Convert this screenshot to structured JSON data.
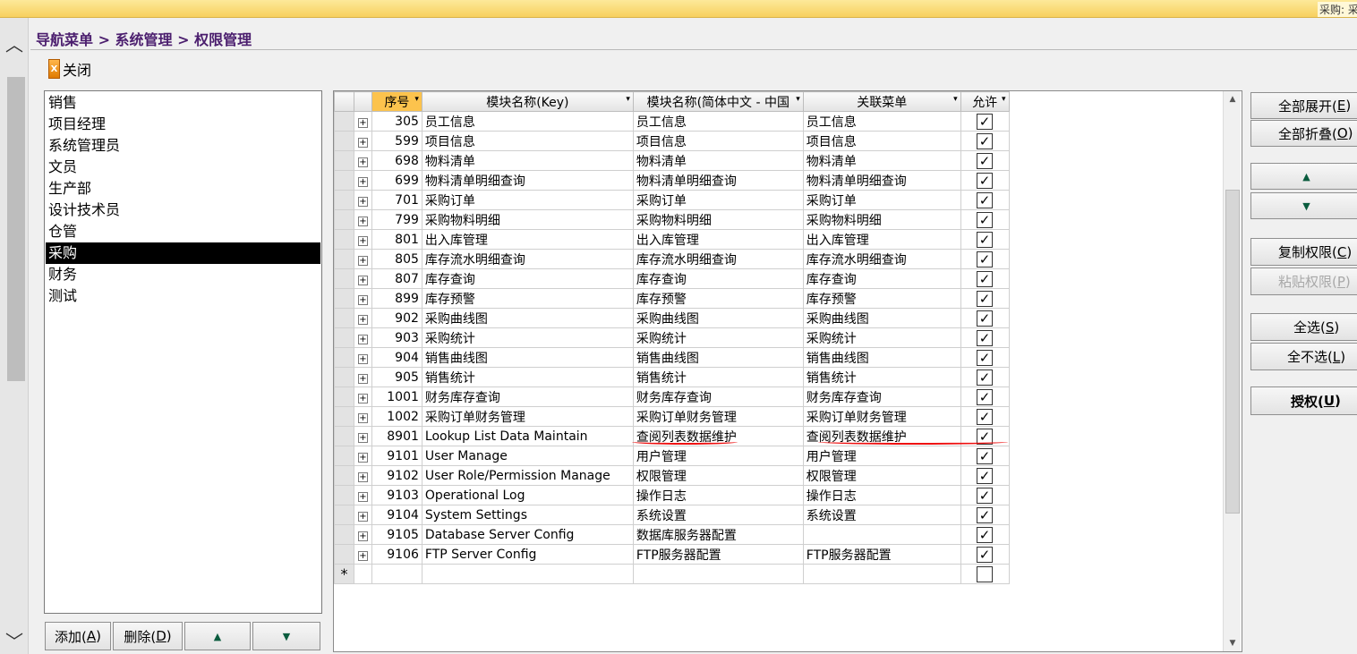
{
  "topbar": {
    "user_label": "采购: 采购"
  },
  "breadcrumb": "导航菜单 > 系统管理 > 权限管理",
  "close_label": "关闭",
  "roles": [
    "销售",
    "项目经理",
    "系统管理员",
    "文员",
    "生产部",
    "设计技术员",
    "仓管",
    "采购",
    "财务",
    "测试"
  ],
  "selected_role": "采购",
  "bottom_buttons": {
    "add": "添加(",
    "add_key": "A",
    "delete": "删除(",
    "delete_key": "D"
  },
  "columns": {
    "seq": "序号",
    "key": "模块名称(Key)",
    "cn": "模块名称(简体中文 - 中国",
    "menu": "关联菜单",
    "allow": "允许"
  },
  "rows": [
    {
      "seq": "305",
      "key": "员工信息",
      "cn": "员工信息",
      "menu": "员工信息",
      "allow": true
    },
    {
      "seq": "599",
      "key": "项目信息",
      "cn": "项目信息",
      "menu": "项目信息",
      "allow": true
    },
    {
      "seq": "698",
      "key": "物料清单",
      "cn": "物料清单",
      "menu": "物料清单",
      "allow": true
    },
    {
      "seq": "699",
      "key": "物料清单明细查询",
      "cn": "物料清单明细查询",
      "menu": "物料清单明细查询",
      "allow": true
    },
    {
      "seq": "701",
      "key": "采购订单",
      "cn": "采购订单",
      "menu": "采购订单",
      "allow": true
    },
    {
      "seq": "799",
      "key": "采购物料明细",
      "cn": "采购物料明细",
      "menu": "采购物料明细",
      "allow": true
    },
    {
      "seq": "801",
      "key": "出入库管理",
      "cn": "出入库管理",
      "menu": "出入库管理",
      "allow": true
    },
    {
      "seq": "805",
      "key": "库存流水明细查询",
      "cn": "库存流水明细查询",
      "menu": "库存流水明细查询",
      "allow": true
    },
    {
      "seq": "807",
      "key": "库存查询",
      "cn": "库存查询",
      "menu": "库存查询",
      "allow": true
    },
    {
      "seq": "899",
      "key": "库存预警",
      "cn": "库存预警",
      "menu": "库存预警",
      "allow": true
    },
    {
      "seq": "902",
      "key": "采购曲线图",
      "cn": "采购曲线图",
      "menu": "采购曲线图",
      "allow": true
    },
    {
      "seq": "903",
      "key": "采购统计",
      "cn": "采购统计",
      "menu": "采购统计",
      "allow": true
    },
    {
      "seq": "904",
      "key": "销售曲线图",
      "cn": "销售曲线图",
      "menu": "销售曲线图",
      "allow": true
    },
    {
      "seq": "905",
      "key": "销售统计",
      "cn": "销售统计",
      "menu": "销售统计",
      "allow": true
    },
    {
      "seq": "1001",
      "key": "财务库存查询",
      "cn": "财务库存查询",
      "menu": "财务库存查询",
      "allow": true
    },
    {
      "seq": "1002",
      "key": "采购订单财务管理",
      "cn": "采购订单财务管理",
      "menu": "采购订单财务管理",
      "allow": true
    },
    {
      "seq": "8901",
      "key": "Lookup List Data Maintain",
      "cn": "查阅列表数据维护",
      "menu": "查阅列表数据维护",
      "allow": true
    },
    {
      "seq": "9101",
      "key": "User Manage",
      "cn": "用户管理",
      "menu": "用户管理",
      "allow": true
    },
    {
      "seq": "9102",
      "key": "User Role/Permission Manage",
      "cn": "权限管理",
      "menu": "权限管理",
      "allow": true
    },
    {
      "seq": "9103",
      "key": "Operational Log",
      "cn": "操作日志",
      "menu": "操作日志",
      "allow": true
    },
    {
      "seq": "9104",
      "key": "System Settings",
      "cn": "系统设置",
      "menu": "系统设置",
      "allow": true
    },
    {
      "seq": "9105",
      "key": "Database Server Config",
      "cn": "数据库服务器配置",
      "menu": "",
      "allow": true
    },
    {
      "seq": "9106",
      "key": "FTP Server Config",
      "cn": "FTP服务器配置",
      "menu": "FTP服务器配置",
      "allow": true
    }
  ],
  "new_row_marker": "*",
  "side_buttons": {
    "expand_all": "全部展开(",
    "expand_key": "E",
    "expand_end": ")",
    "collapse_all": "全部折叠(",
    "collapse_key": "O",
    "collapse_end": ")",
    "copy": "复制权限(",
    "copy_key": "C",
    "copy_end": ")",
    "paste": "粘贴权限(",
    "paste_key": "P",
    "paste_end": ")",
    "select_all": "全选(",
    "select_all_key": "S",
    "select_all_end": ")",
    "select_none": "全不选(",
    "select_none_key": "L",
    "select_none_end": ")",
    "authorize": "授权(",
    "authorize_key": "U",
    "authorize_end": ")"
  },
  "colors": {
    "accent_header": "#fcc34d",
    "breadcrumb": "#4b1e6e",
    "annotation": "#e11"
  }
}
